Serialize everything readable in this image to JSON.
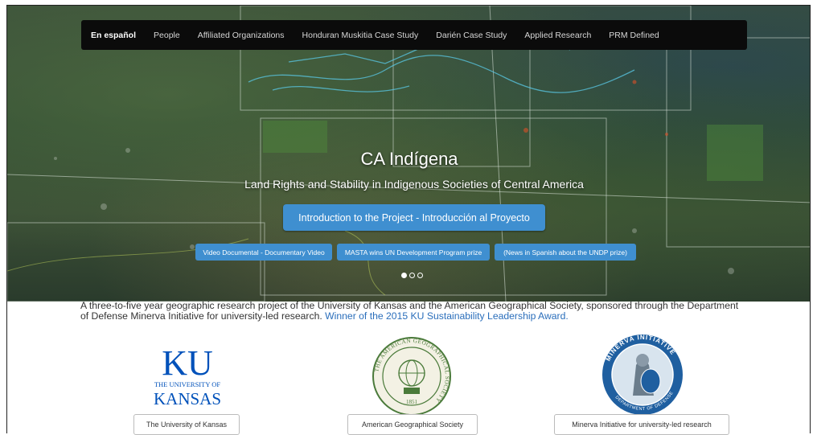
{
  "nav": {
    "items": [
      {
        "label": "En español",
        "active": true
      },
      {
        "label": "People"
      },
      {
        "label": "Affiliated Organizations"
      },
      {
        "label": "Honduran Muskitia Case Study"
      },
      {
        "label": "Darién Case Study"
      },
      {
        "label": "Applied Research"
      },
      {
        "label": "PRM Defined"
      }
    ]
  },
  "hero": {
    "title": "CA Indígena",
    "subtitle": "Land Rights and Stability in Indigenous Societies of Central America",
    "primary_button": "Introduction to the Project - Introducción al Proyecto",
    "buttons": [
      "Video Documental - Documentary Video",
      "MASTA wins UN Development Program prize",
      "(News in Spanish about the UNDP prize)"
    ],
    "carousel": {
      "slides": 3,
      "active": 1
    }
  },
  "description": {
    "text": "A three-to-five year geographic research project of the University of Kansas and the American Geographical Society, sponsored through the Department of Defense Minerva Initiative for university-led research.",
    "link": "Winner of the 2015 KU Sustainability Leadership Award."
  },
  "partners": [
    {
      "name": "The University of Kansas",
      "logo_text": "KU",
      "logo_sub1": "THE UNIVERSITY OF",
      "logo_sub2": "KANSAS"
    },
    {
      "name": "American Geographical Society",
      "logo_text": "THE AMERICAN GEOGRAPHICAL SOCIETY",
      "logo_year": "1851"
    },
    {
      "name": "Minerva Initiative for university-led research",
      "logo_text": "MINERVA INITIATIVE",
      "logo_sub": "DEPARTMENT OF DEFENSE"
    }
  ],
  "colors": {
    "accent": "#3f8fd0",
    "navbar": "#0b0b0b",
    "ku_blue": "#0051ba",
    "ags_green": "#4a7a3a",
    "minerva_blue": "#1f5fa0",
    "link": "#2a6ebb"
  }
}
